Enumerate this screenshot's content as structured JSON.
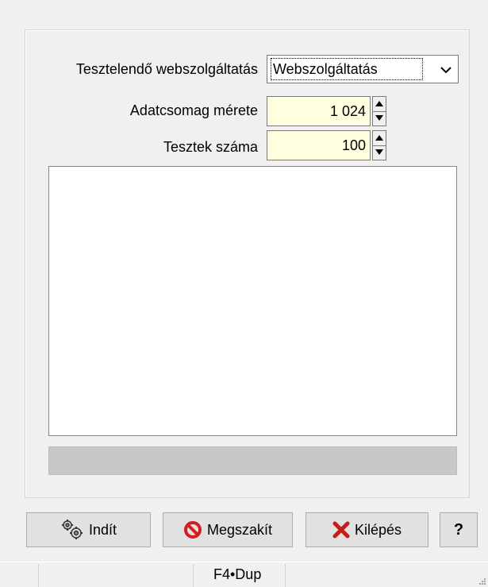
{
  "form": {
    "service_label": "Tesztelendő webszolgáltatás",
    "service_value": "Webszolgáltatás",
    "packet_size_label": "Adatcsomag mérete",
    "packet_size_value": "1 024",
    "test_count_label": "Tesztek száma",
    "test_count_value": "100",
    "log_text": "",
    "progress": 0
  },
  "buttons": {
    "start_label": "Indít",
    "abort_label": "Megszakít",
    "exit_label": "Kilépés",
    "help_label": "?"
  },
  "status_bar": {
    "pane_text": "F4•Dup"
  },
  "icons": {
    "start": "gears-icon",
    "abort": "prohibited-icon",
    "exit": "red-x-icon",
    "combo_arrow": "chevron-down-icon",
    "spin_up": "triangle-up-icon",
    "spin_down": "triangle-down-icon"
  },
  "colors": {
    "window_bg": "#f0f0f0",
    "input_highlight": "#ffffe0",
    "abort_red": "#d11f1f",
    "exit_red": "#c61c1c"
  }
}
